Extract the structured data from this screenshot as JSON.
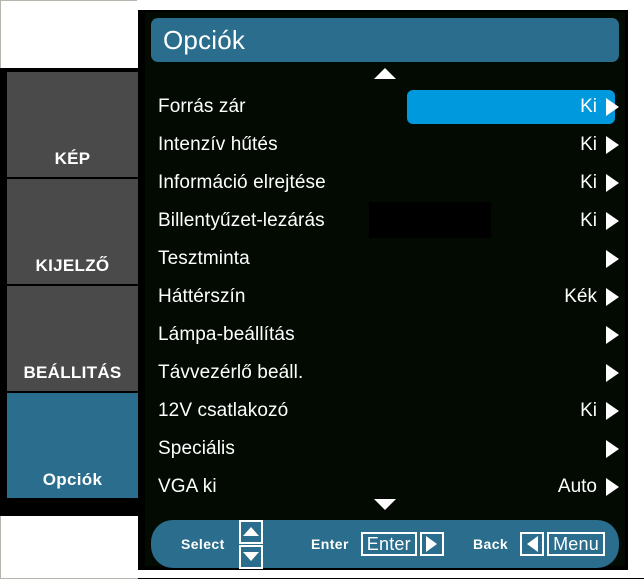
{
  "colors": {
    "accent_title": "#2a6d8c",
    "accent_highlight": "#0099de",
    "tab_inactive": "#4a4a4a",
    "panel_bg": "#020a02",
    "text": "#ffffff",
    "plate": "#ffffff"
  },
  "sidebar": {
    "items": [
      {
        "label": "KÉP",
        "active": false
      },
      {
        "label": "KIJELZŐ",
        "active": false
      },
      {
        "label": "BEÁLLITÁS",
        "active": false
      },
      {
        "label": "Opciók",
        "active": true
      }
    ]
  },
  "panel": {
    "title": "Opciók",
    "scroll_up_icon": "triangle-up-icon",
    "scroll_down_icon": "triangle-down-icon",
    "rows": [
      {
        "label": "Forrás zár",
        "value": "Ki",
        "selected": true,
        "arrow": "chevron-right-icon"
      },
      {
        "label": "Intenzív hűtés",
        "value": "Ki",
        "selected": false,
        "arrow": "chevron-right-icon"
      },
      {
        "label": "Információ elrejtése",
        "value": "Ki",
        "selected": false,
        "arrow": "chevron-right-icon"
      },
      {
        "label": "Billentyűzet-lezárás",
        "value": "Ki",
        "selected": false,
        "arrow": "chevron-right-icon"
      },
      {
        "label": "Tesztminta",
        "value": "",
        "selected": false,
        "arrow": "chevron-right-icon"
      },
      {
        "label": "Háttérszín",
        "value": "Kék",
        "selected": false,
        "arrow": "chevron-right-icon"
      },
      {
        "label": "Lámpa-beállítás",
        "value": "",
        "selected": false,
        "arrow": "chevron-right-icon"
      },
      {
        "label": "Távvezérlő beáll.",
        "value": "",
        "selected": false,
        "arrow": "chevron-right-icon"
      },
      {
        "label": "12V csatlakozó",
        "value": "Ki",
        "selected": false,
        "arrow": "chevron-right-icon"
      },
      {
        "label": "Speciális",
        "value": "",
        "selected": false,
        "arrow": "chevron-right-icon"
      },
      {
        "label": "VGA ki",
        "value": "Auto",
        "selected": false,
        "arrow": "chevron-right-icon"
      }
    ]
  },
  "helpbar": {
    "select": {
      "label": "Select",
      "keys": [
        "triangle-up-icon",
        "triangle-down-icon"
      ]
    },
    "enter": {
      "label": "Enter",
      "key_text": "Enter",
      "key_icon": "triangle-right-icon"
    },
    "back": {
      "label": "Back",
      "key_icon": "triangle-left-icon",
      "key_text": "Menu"
    }
  }
}
